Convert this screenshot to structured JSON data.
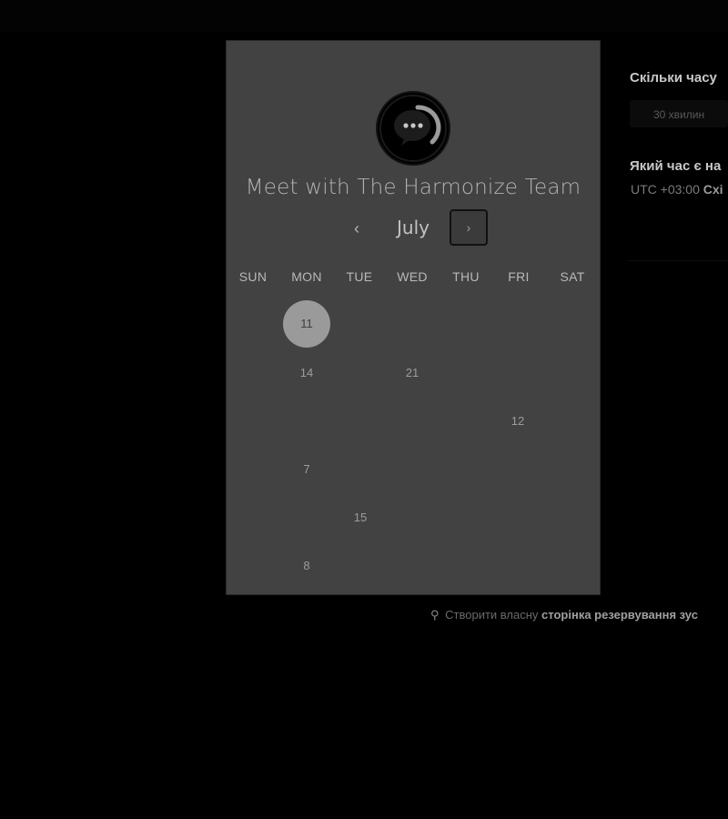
{
  "calendar": {
    "team_name": "Meet with The Harmonize Team",
    "month": "July",
    "prev_icon": "chevron-left-icon",
    "next_icon": "chevron-right-icon",
    "weekdays": [
      "SUN",
      "MON",
      "TUE",
      "WED",
      "THU",
      "FRI",
      "SAT"
    ],
    "selected_day": "11",
    "days": [
      "11",
      "14",
      "21",
      "12",
      "7",
      "15",
      "8"
    ]
  },
  "sidebar": {
    "duration_heading": "Скільки часу",
    "duration_option": "30 хвилин",
    "time_heading": "Який час є на",
    "timezone_prefix": "UTC +03:00",
    "timezone_name": "Схі"
  },
  "footer": {
    "icon": "hubspot-sprocket-icon",
    "text": "Створити власну",
    "link": "сторінка резервування зус"
  },
  "colors": {
    "page_background": "#000000",
    "panel_background": "#424242",
    "selected_day": "#9a9a9a"
  }
}
